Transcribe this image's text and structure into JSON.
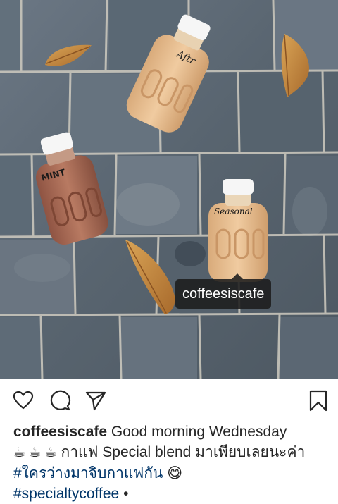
{
  "post": {
    "photo_tag": "coffeesiscafe",
    "bottle_labels": {
      "top": "Aftr",
      "left": "MINT",
      "right": "Seasonal"
    }
  },
  "actions": {
    "like_icon": "heart-outline-icon",
    "comment_icon": "speech-bubble-icon",
    "share_icon": "paper-plane-icon",
    "save_icon": "bookmark-outline-icon"
  },
  "caption": {
    "username": "coffeesiscafe",
    "line1_text": "Good morning Wednesday",
    "cups": "☕ ☕ ☕",
    "line2_text": "กาแฟ Special blend มาเพียบเลยนะค่า",
    "hashtag1": "#ใครว่างมาจิบกาแฟกัน",
    "emoji": "😋",
    "hashtag2": "#specialtycoffee",
    "trailing": "•"
  },
  "colors": {
    "stone": "#5f6c78",
    "grout": "#d9d6cc",
    "coffee_bottle": "#e2b98c",
    "mint_bottle": "#a86a55",
    "hashtag": "#003569",
    "text": "#262626"
  }
}
